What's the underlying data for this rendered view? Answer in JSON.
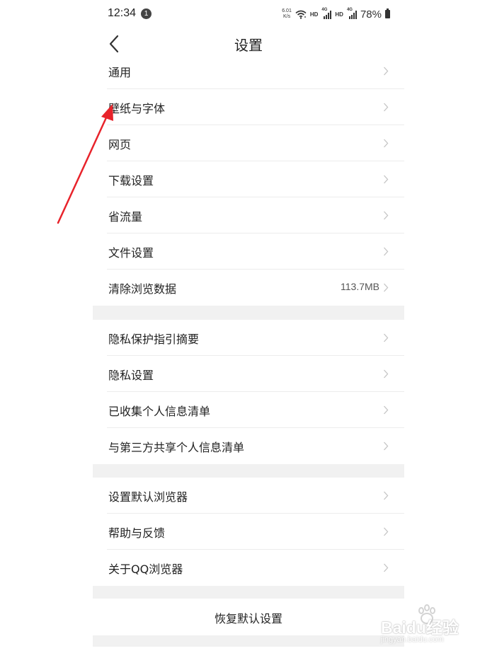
{
  "status_bar": {
    "time": "12:34",
    "notification_count": "1",
    "net_speed_value": "6.01",
    "net_speed_unit": "K/s",
    "hd_label": "HD",
    "network_label": "4G",
    "battery_percent": "78%"
  },
  "header": {
    "title": "设置",
    "back_icon": "chevron-left-icon"
  },
  "groups": [
    {
      "items": [
        {
          "label": "通用",
          "value": ""
        },
        {
          "label": "壁纸与字体",
          "value": ""
        },
        {
          "label": "网页",
          "value": ""
        },
        {
          "label": "下载设置",
          "value": ""
        },
        {
          "label": "省流量",
          "value": ""
        },
        {
          "label": "文件设置",
          "value": ""
        },
        {
          "label": "清除浏览数据",
          "value": "113.7MB"
        }
      ]
    },
    {
      "items": [
        {
          "label": "隐私保护指引摘要",
          "value": ""
        },
        {
          "label": "隐私设置",
          "value": ""
        },
        {
          "label": "已收集个人信息清单",
          "value": ""
        },
        {
          "label": "与第三方共享个人信息清单",
          "value": ""
        }
      ]
    },
    {
      "items": [
        {
          "label": "设置默认浏览器",
          "value": ""
        },
        {
          "label": "帮助与反馈",
          "value": ""
        },
        {
          "label": "关于QQ浏览器",
          "value": ""
        }
      ]
    }
  ],
  "restore_button": {
    "label": "恢复默认设置"
  },
  "annotation": {
    "arrow_color": "#e8232b"
  },
  "watermark": {
    "main": "Baidu经验",
    "sub": "jingyan.baidu.com"
  },
  "colors": {
    "page_background": "#ffffff",
    "list_background": "#f1f1f1",
    "text": "#222222",
    "chevron": "#c4c4c4"
  }
}
